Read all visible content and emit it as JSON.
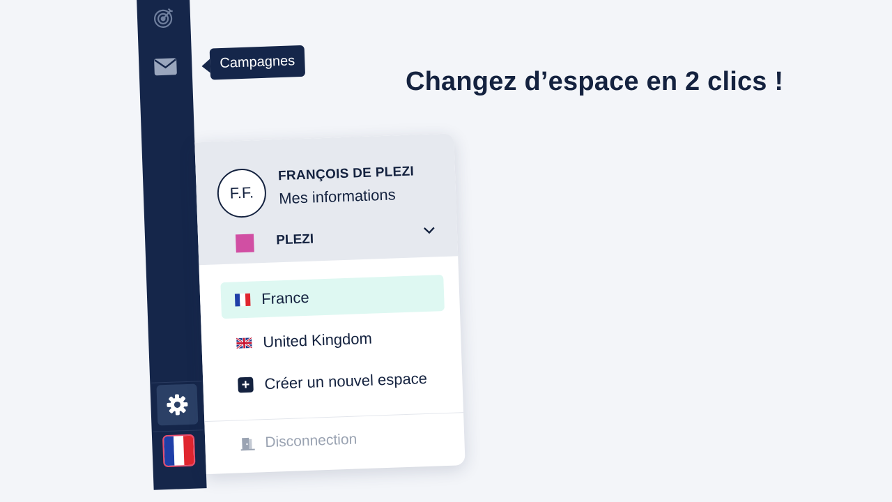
{
  "headline": "Changez d’espace en 2 clics !",
  "sidebar": {
    "icons": [
      "target-icon",
      "mail-icon",
      "gear-icon",
      "france-flag-icon"
    ],
    "tooltip": "Campagnes"
  },
  "menu": {
    "avatar_initials": "F.F.",
    "user_name": "FRANÇOIS DE PLEZI",
    "user_link": "Mes informations",
    "org": {
      "name": "PLEZI",
      "color": "#d14fa3"
    },
    "spaces": [
      {
        "label": "France",
        "flag": "france-flag-icon",
        "active": true
      },
      {
        "label": "United Kingdom",
        "flag": "uk-flag-icon",
        "active": false
      }
    ],
    "create_label": "Créer un nouvel espace",
    "logout_label": "Disconnection"
  },
  "colors": {
    "navy": "#15264a",
    "active_bg": "#def8f2",
    "france_blue": "#1f3fa8",
    "france_red": "#e0262f"
  }
}
